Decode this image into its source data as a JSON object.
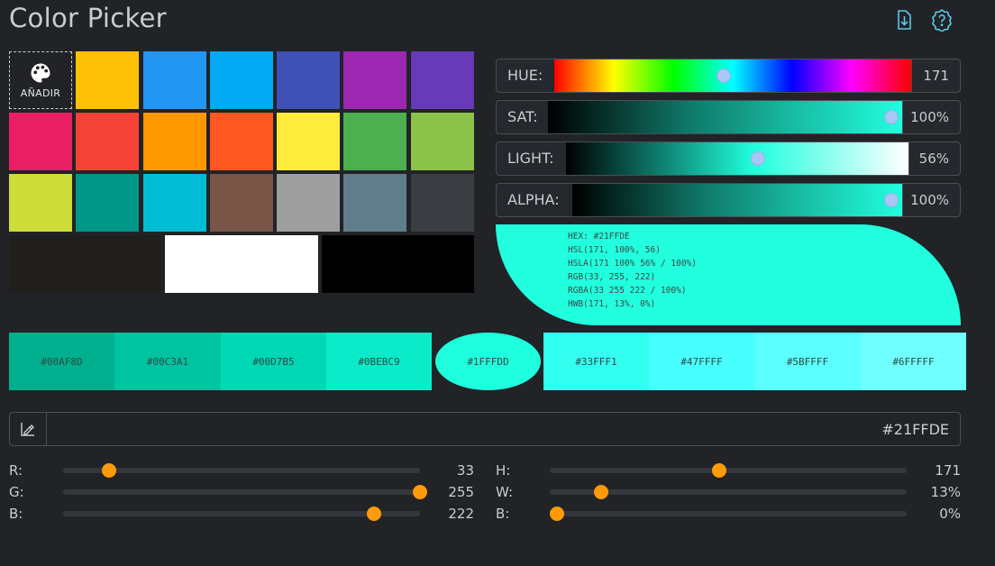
{
  "app": {
    "title": "Color Picker"
  },
  "toolbar": {
    "download_icon": "download-icon",
    "help_icon": "help-icon"
  },
  "palette": {
    "add_label": "AÑADIR",
    "swatches": [
      "#FFC107",
      "#2196F3",
      "#03A9F4",
      "#3F51B5",
      "#9C27B0",
      "#673AB7",
      "#E91E63",
      "#F44336",
      "#FF9800",
      "#FF5722",
      "#FFEB3B",
      "#4CAF50",
      "#8BC34A",
      "#CDDC39",
      "#009688",
      "#00BCD4",
      "#795548",
      "#9E9E9E",
      "#607D8B",
      "#3A3D42"
    ],
    "wide": [
      "#201f1e",
      "#FFFFFF",
      "#000000"
    ]
  },
  "hsl": {
    "hue": {
      "label": "HUE:",
      "value": "171",
      "level": 0.475
    },
    "sat": {
      "label": "SAT:",
      "value": "100%",
      "level": 1.0
    },
    "light": {
      "label": "LIGHT:",
      "value": "56%",
      "level": 0.56
    },
    "alpha": {
      "label": "ALPHA:",
      "value": "100%",
      "level": 1.0
    }
  },
  "preview": {
    "color": "#21FFDE",
    "lines": [
      "HEX: #21FFDE",
      "HSL(171, 100%, 56)",
      "HSLA(171 100% 56% / 100%)",
      "RGB(33, 255, 222)",
      "RGBA(33 255 222 / 100%)",
      "HWB(171, 13%, 0%)"
    ]
  },
  "shades": [
    {
      "label": "#00AF8D",
      "color": "#00AF8D"
    },
    {
      "label": "#00C3A1",
      "color": "#00C3A1"
    },
    {
      "label": "#00D7B5",
      "color": "#00D7B5"
    },
    {
      "label": "#0BEBC9",
      "color": "#0BEBC9"
    },
    {
      "label": "#1FFFDD",
      "color": "#1FFFDD"
    },
    {
      "label": "#33FFF1",
      "color": "#33FFF1"
    },
    {
      "label": "#47FFFF",
      "color": "#47FFFF"
    },
    {
      "label": "#5BFFFF",
      "color": "#5BFFFF"
    },
    {
      "label": "#6FFFFF",
      "color": "#6FFFFF"
    }
  ],
  "hex_input": {
    "value": "#21FFDE"
  },
  "rgb": [
    {
      "label": "R:",
      "value": "33",
      "level": 0.129
    },
    {
      "label": "G:",
      "value": "255",
      "level": 1.0
    },
    {
      "label": "B:",
      "value": "222",
      "level": 0.87
    }
  ],
  "hwb": [
    {
      "label": "H:",
      "value": "171",
      "level": 0.475
    },
    {
      "label": "W:",
      "value": "13%",
      "level": 0.145
    },
    {
      "label": "B:",
      "value": "0%",
      "level": 0.02
    }
  ],
  "colors": {
    "accent": "#21FFDE",
    "slider_knob": "#FF9A0A",
    "hsl_knob": "#A9C6F5",
    "icon": "#5BC8E8"
  }
}
